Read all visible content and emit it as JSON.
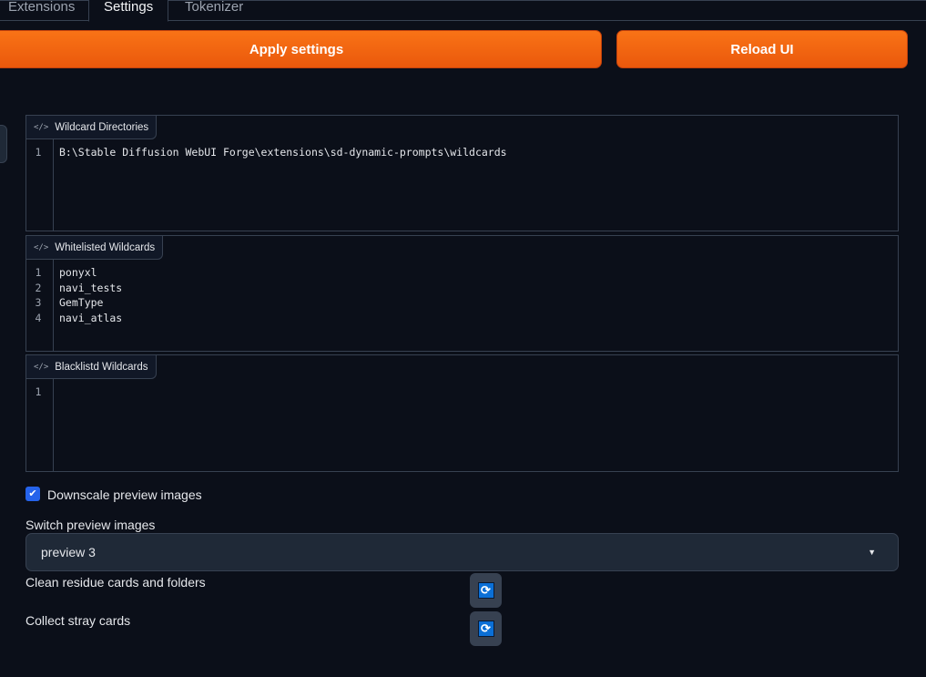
{
  "tabs": [
    "Extensions",
    "Settings",
    "Tokenizer"
  ],
  "buttons": {
    "apply": "Apply settings",
    "reload": "Reload UI"
  },
  "wildcard_directories": {
    "label": "Wildcard Directories",
    "lines": [
      "B:\\Stable Diffusion WebUI Forge\\extensions\\sd-dynamic-prompts\\wildcards"
    ]
  },
  "whitelisted": {
    "label": "Whitelisted Wildcards",
    "lines": [
      "ponyxl",
      "navi_tests",
      "GemType",
      "navi_atlas"
    ]
  },
  "blacklisted": {
    "label": "Blacklistd Wildcards",
    "lines": [
      ""
    ]
  },
  "downscale": {
    "label": "Downscale preview images",
    "checked": true
  },
  "switch_preview": {
    "label": "Switch preview images",
    "value": "preview 3"
  },
  "clean": {
    "label": "Clean residue cards and folders"
  },
  "collect": {
    "label": "Collect stray cards"
  },
  "icons": {
    "code": "</>",
    "refresh": "⟳",
    "check": "✔",
    "caret": "▼"
  }
}
